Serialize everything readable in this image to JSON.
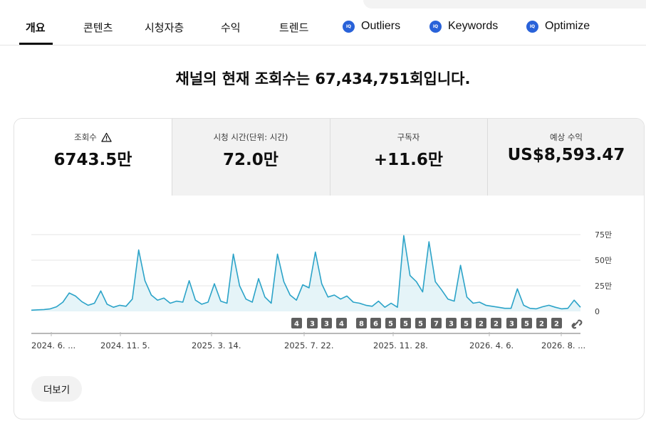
{
  "tabs": [
    {
      "label": "개요",
      "active": true
    },
    {
      "label": "콘텐츠"
    },
    {
      "label": "시청자층"
    },
    {
      "label": "수익"
    },
    {
      "label": "트렌드"
    }
  ],
  "extensions": [
    {
      "label": "Outliers",
      "icon": "vidiq-icon"
    },
    {
      "label": "Keywords",
      "icon": "vidiq-icon"
    },
    {
      "label": "Optimize",
      "icon": "vidiq-icon"
    }
  ],
  "headline": "채널의 현재 조회수는 67,434,751회입니다.",
  "metrics": [
    {
      "label": "조회수",
      "value": "6743.5만",
      "selected": true,
      "warning_icon": "warning-triangle-icon"
    },
    {
      "label": "시청 시간(단위: 시간)",
      "value": "72.0만"
    },
    {
      "label": "구독자",
      "value": "+11.6만"
    },
    {
      "label": "예상 수익",
      "value": "US$8,593.47"
    }
  ],
  "chart_data": {
    "type": "area",
    "color": "#2ba3c8",
    "y_tick_labels": [
      "75만",
      "50만",
      "25만",
      "0"
    ],
    "y_ticks": [
      750000,
      500000,
      250000,
      0
    ],
    "ylim": [
      0,
      800000
    ],
    "x_tick_labels": [
      "2024. 6. ...",
      "2024. 11. 5.",
      "2025. 3. 14.",
      "2025. 7. 22.",
      "2025. 11. 28.",
      "2026. 4. 6.",
      "2026. 8. ..."
    ],
    "x_range": [
      "2024-06",
      "2026-08"
    ],
    "approx_series": {
      "start": "2024-06",
      "step": "approx. weekly",
      "values": [
        12000,
        15000,
        18000,
        25000,
        45000,
        90000,
        180000,
        150000,
        95000,
        60000,
        80000,
        200000,
        70000,
        40000,
        60000,
        50000,
        120000,
        600000,
        300000,
        160000,
        110000,
        130000,
        80000,
        100000,
        90000,
        300000,
        110000,
        70000,
        90000,
        270000,
        100000,
        80000,
        560000,
        250000,
        120000,
        90000,
        320000,
        140000,
        80000,
        560000,
        290000,
        160000,
        110000,
        260000,
        230000,
        580000,
        270000,
        140000,
        160000,
        120000,
        150000,
        90000,
        80000,
        60000,
        50000,
        100000,
        40000,
        80000,
        40000,
        740000,
        350000,
        290000,
        190000,
        680000,
        290000,
        210000,
        120000,
        100000,
        450000,
        140000,
        80000,
        90000,
        60000,
        50000,
        40000,
        30000,
        30000,
        220000,
        60000,
        30000,
        25000,
        45000,
        60000,
        40000,
        25000,
        30000,
        110000,
        40000
      ]
    }
  },
  "annotation_markers": [
    "4",
    "3",
    "3",
    "4",
    "8",
    "6",
    "5",
    "5",
    "5",
    "7",
    "3",
    "5",
    "2",
    "2",
    "3",
    "5",
    "2",
    "2"
  ],
  "more_button": "더보기"
}
